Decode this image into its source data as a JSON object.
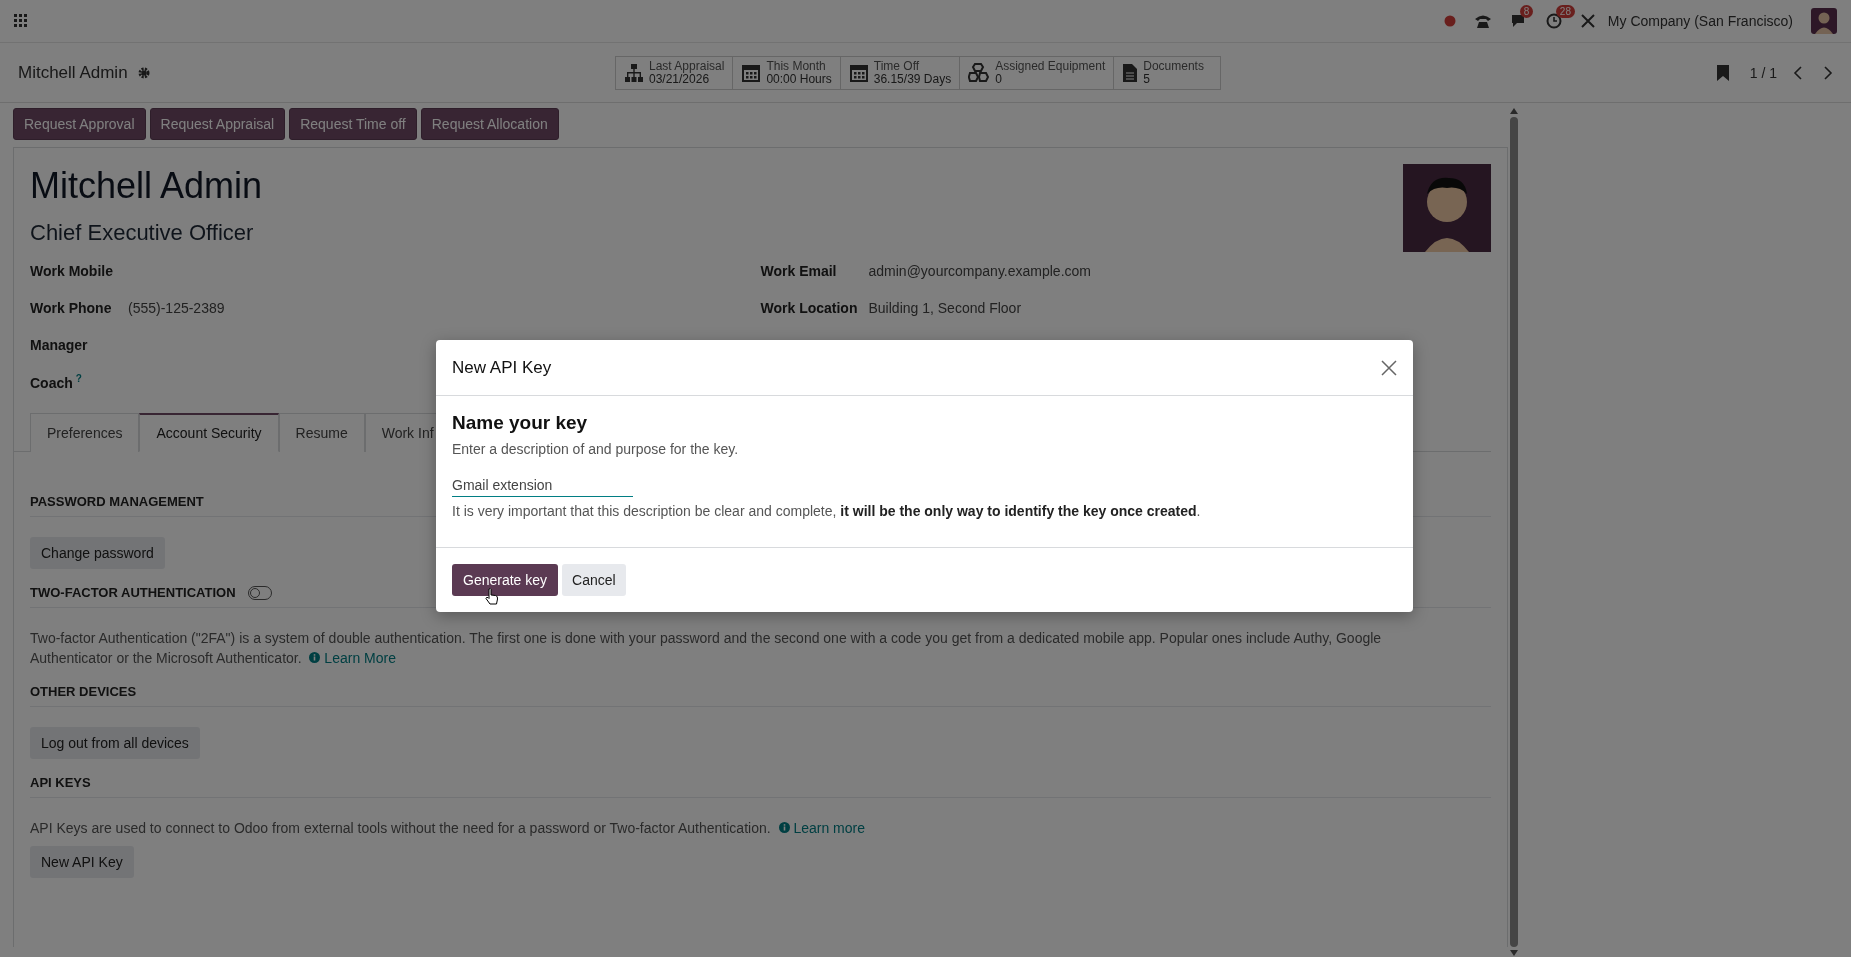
{
  "navbar": {
    "systray": {
      "chat_badge": "8",
      "activity_badge": "28",
      "company": "My Company (San Francisco)"
    }
  },
  "control_panel": {
    "breadcrumb": "Mitchell Admin",
    "stat_buttons": [
      {
        "kind": "org",
        "label": "Last Appraisal",
        "value": "03/21/2026"
      },
      {
        "kind": "calendar",
        "label": "This Month",
        "value": "00:00 Hours"
      },
      {
        "kind": "calendar",
        "label": "Time Off",
        "value": "36.15/39 Days"
      },
      {
        "kind": "cubes",
        "label": "Assigned Equipment",
        "value": "0"
      },
      {
        "kind": "file",
        "label": "Documents",
        "value": "5"
      }
    ],
    "pager": "1 / 1"
  },
  "header_buttons": [
    "Request Approval",
    "Request Appraisal",
    "Request Time off",
    "Request Allocation"
  ],
  "employee": {
    "name": "Mitchell Admin",
    "job_title": "Chief Executive Officer",
    "fields_left": [
      {
        "label": "Work Mobile"
      },
      {
        "label": "Work Phone",
        "value": "(555)-125-2389"
      },
      {
        "label": "Manager"
      },
      {
        "label": "Coach",
        "help": "?"
      }
    ],
    "fields_right": [
      {
        "label": "Work Email",
        "value": "admin@yourcompany.example.com"
      },
      {
        "label": "Work Location",
        "value": "Building 1, Second Floor"
      }
    ]
  },
  "tabs": [
    {
      "label": "Preferences",
      "selected": false
    },
    {
      "label": "Account Security",
      "selected": true
    },
    {
      "label": "Resume",
      "selected": false
    },
    {
      "label": "Work Inf",
      "selected": false
    }
  ],
  "sections": [
    {
      "title": "PASSWORD MANAGEMENT",
      "button": "Change password"
    },
    {
      "title": "TWO-FACTOR AUTHENTICATION",
      "toggle": {
        "on": false
      },
      "description": "Two-factor Authentication (\"2FA\") is a system of double authentication. The first one is done with your password and the second one with a code you get from a dedicated mobile app. Popular ones include Authy, Google Authenticator or the Microsoft Authenticator.",
      "link": "Learn More"
    },
    {
      "title": "OTHER DEVICES",
      "button": "Log out from all devices"
    },
    {
      "title": "API KEYS",
      "description": "API Keys are used to connect to Odoo from external tools without the need for a password or Two-factor Authentication.",
      "link": "Learn more",
      "button": "New API Key"
    }
  ],
  "dialog": {
    "title": "New API Key",
    "heading": "Name your key",
    "description": "Enter a description of and purpose for the key.",
    "input_value": "Gmail extension",
    "note": "It is very important that this description be clear and complete, **it will be the only way to identify the key once created**.",
    "buttons": [
      {
        "label": "Generate key",
        "kind": "primary"
      },
      {
        "label": "Cancel",
        "kind": "secondary"
      }
    ]
  }
}
